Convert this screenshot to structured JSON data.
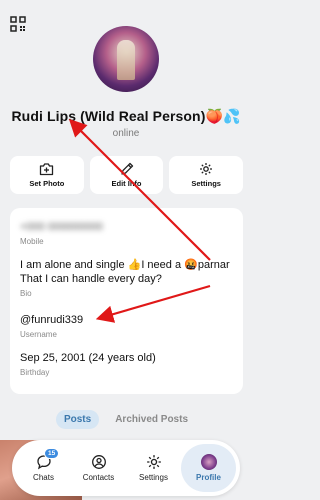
{
  "header": {
    "qr_icon": "qr-code-icon"
  },
  "profile": {
    "name": "Rudi Lips (Wild Real Person)🍑💦",
    "status": "online"
  },
  "actions": [
    {
      "label": "Set Photo",
      "icon": "camera-plus-icon"
    },
    {
      "label": "Edit Info",
      "icon": "pencil-icon"
    },
    {
      "label": "Settings",
      "icon": "gear-icon"
    }
  ],
  "info": {
    "mobile": {
      "value": "+000 000000000",
      "label": "Mobile"
    },
    "bio": {
      "value": "I am alone and single 👍I need a 🤬parnar That I can handle every day?",
      "label": "Bio"
    },
    "username": {
      "value": "@funrudi339",
      "label": "Username"
    },
    "birthday": {
      "value": "Sep 25, 2001 (24 years old)",
      "label": "Birthday"
    }
  },
  "tabs": [
    {
      "label": "Posts",
      "active": true
    },
    {
      "label": "Archived Posts",
      "active": false
    }
  ],
  "nav": [
    {
      "label": "Chats",
      "icon": "chat-bubble-icon",
      "badge": "15",
      "active": false
    },
    {
      "label": "Contacts",
      "icon": "person-circle-icon",
      "active": false
    },
    {
      "label": "Settings",
      "icon": "gear-icon",
      "active": false
    },
    {
      "label": "Profile",
      "icon": "avatar-icon",
      "active": true
    }
  ],
  "colors": {
    "accent": "#3b78ad",
    "arrow": "#e01818",
    "badge": "#3d8ce0"
  }
}
